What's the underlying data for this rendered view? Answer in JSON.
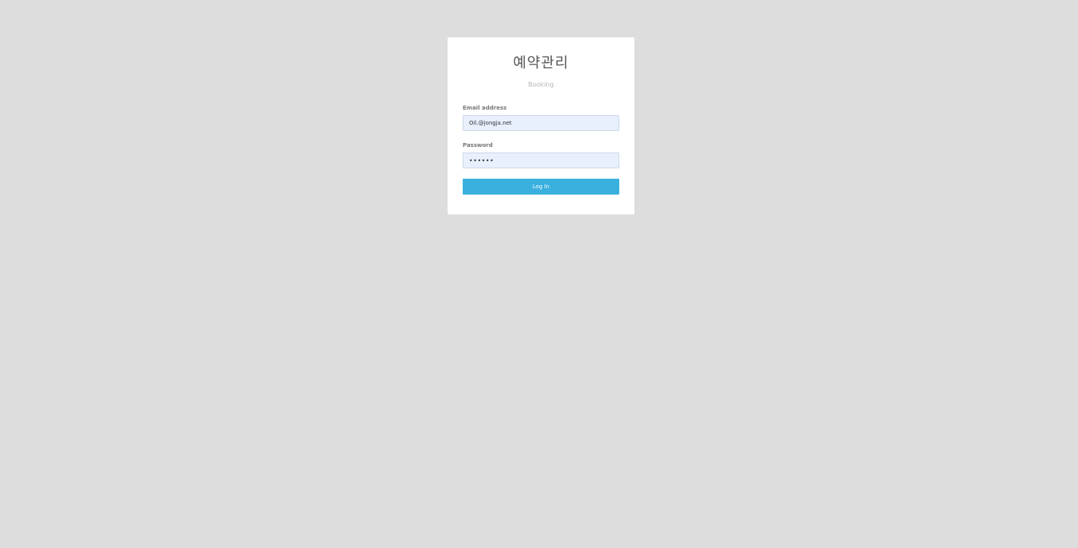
{
  "login": {
    "title": "예약관리",
    "subtitle": "Booking",
    "email": {
      "label": "Email address",
      "value": "Oil.@jongja.net"
    },
    "password": {
      "label": "Password",
      "value": "••••••"
    },
    "submit_label": "Log In"
  },
  "colors": {
    "page_background": "#dddddd",
    "card_background": "#ffffff",
    "input_background": "#e8f0fe",
    "button_background": "#3ab0df",
    "button_text": "#ffffff"
  }
}
